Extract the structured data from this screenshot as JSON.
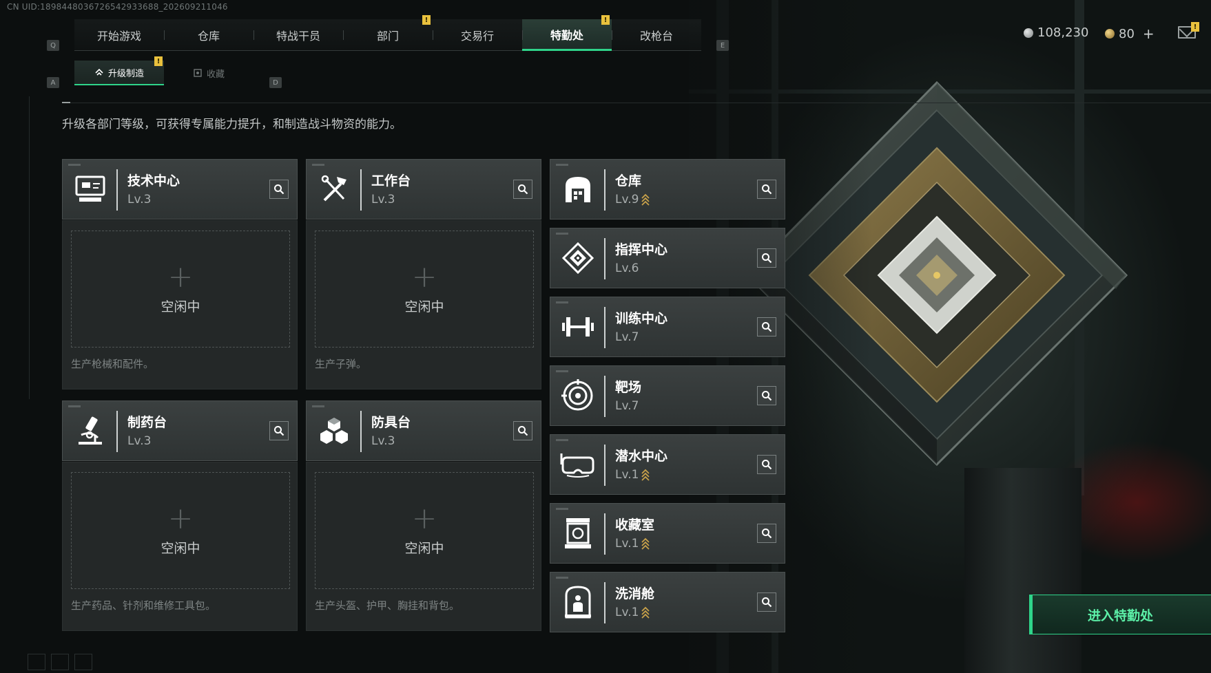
{
  "uid": "CN UID:1898448036726542933688_202609211046",
  "nav": {
    "left_key": "Q",
    "right_key": "E",
    "tabs": [
      {
        "label": "开始游戏",
        "active": false
      },
      {
        "label": "仓库",
        "active": false
      },
      {
        "label": "特战干员",
        "active": false
      },
      {
        "label": "部门",
        "active": false,
        "notice": true
      },
      {
        "label": "交易行",
        "active": false
      },
      {
        "label": "特勤处",
        "active": true,
        "notice": true
      },
      {
        "label": "改枪台",
        "active": false
      }
    ]
  },
  "currency": {
    "primary": "108,230",
    "secondary": "80",
    "add": "+",
    "primary_color": "#b8bcbc",
    "secondary_color": "#c9a24a"
  },
  "notice_mark": "!",
  "subnav": {
    "left_key": "A",
    "right_key": "D",
    "tabs": [
      {
        "label": "升级制造",
        "active": true,
        "icon": "upgrade-icon",
        "notice": true
      },
      {
        "label": "收藏",
        "active": false,
        "icon": "collection-icon"
      }
    ]
  },
  "description": "升级各部门等级，可获得专属能力提升，和制造战斗物资的能力。",
  "production_stations": [
    {
      "name": "技术中心",
      "level": "Lv.3",
      "icon": "computer-icon",
      "status": "空闲中",
      "desc": "生产枪械和配件。"
    },
    {
      "name": "工作台",
      "level": "Lv.3",
      "icon": "tools-icon",
      "status": "空闲中",
      "desc": "生产子弹。"
    },
    {
      "name": "制药台",
      "level": "Lv.3",
      "icon": "microscope-icon",
      "status": "空闲中",
      "desc": "生产药品、针剂和维修工具包。"
    },
    {
      "name": "防具台",
      "level": "Lv.3",
      "icon": "armor-cubes-icon",
      "status": "空闲中",
      "desc": "生产头盔、护甲、胸挂和背包。"
    }
  ],
  "facilities": [
    {
      "name": "仓库",
      "level": "Lv.9",
      "icon": "warehouse-icon",
      "upgradable": true
    },
    {
      "name": "指挥中心",
      "level": "Lv.6",
      "icon": "command-icon",
      "upgradable": false
    },
    {
      "name": "训练中心",
      "level": "Lv.7",
      "icon": "dumbbell-icon",
      "upgradable": false
    },
    {
      "name": "靶场",
      "level": "Lv.7",
      "icon": "target-icon",
      "upgradable": false
    },
    {
      "name": "潜水中心",
      "level": "Lv.1",
      "icon": "diving-mask-icon",
      "upgradable": true
    },
    {
      "name": "收藏室",
      "level": "Lv.1",
      "icon": "display-case-icon",
      "upgradable": true
    },
    {
      "name": "洗消舱",
      "level": "Lv.1",
      "icon": "decon-chamber-icon",
      "upgradable": true
    }
  ],
  "enter_button": "进入特勤处",
  "colors": {
    "accent": "#2fd48a",
    "notice": "#e9c13d",
    "upgrade_arrow": "#c9a24a"
  }
}
